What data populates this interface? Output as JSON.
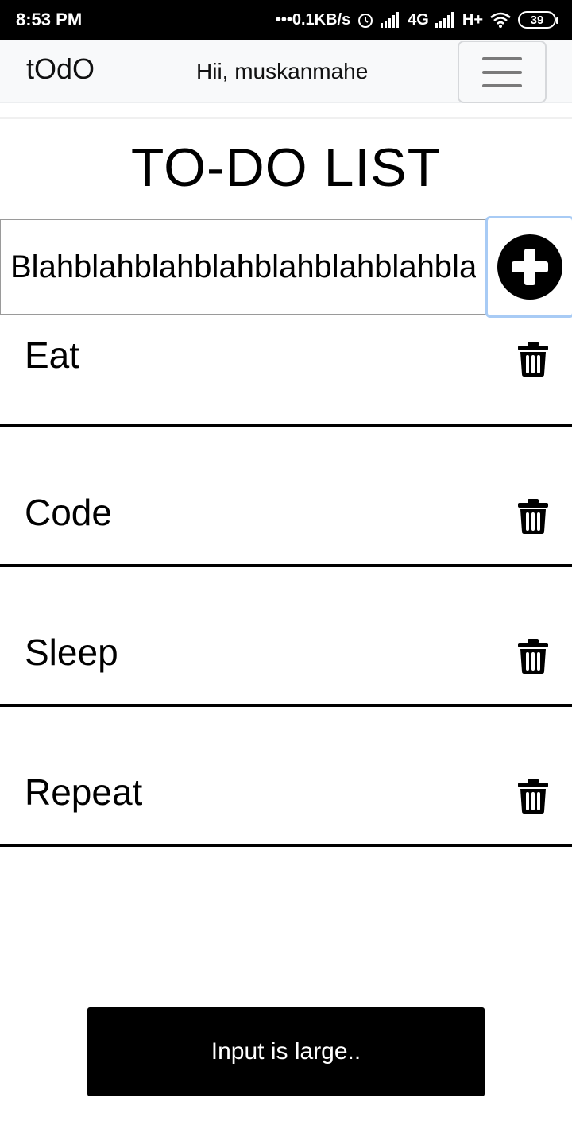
{
  "status_bar": {
    "time": "8:53 PM",
    "network_speed": "•••0.1KB/s",
    "network_4g": "4G",
    "network_hplus": "H+",
    "battery": "39"
  },
  "navbar": {
    "brand": "tOdO",
    "greeting": "Hii, muskanmahe",
    "menu_icon": "hamburger-icon"
  },
  "page": {
    "title": "TO-DO LIST"
  },
  "input": {
    "value": "Blahblahblahblahblahblahblahblahblah",
    "add_icon": "plus-circle-icon"
  },
  "todos": [
    {
      "label": "Eat"
    },
    {
      "label": "Code"
    },
    {
      "label": "Sleep"
    },
    {
      "label": "Repeat"
    }
  ],
  "delete_icon": "trash-icon",
  "toast": {
    "message": "Input is large.."
  }
}
